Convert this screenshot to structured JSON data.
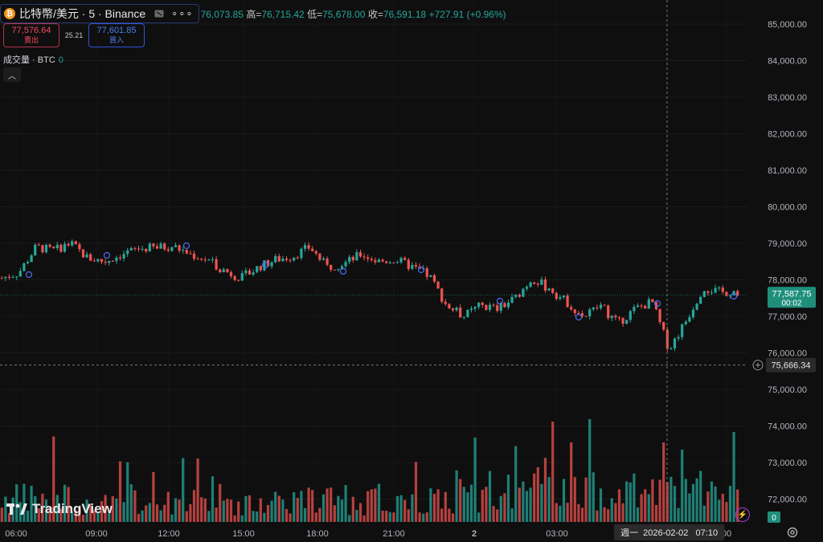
{
  "header": {
    "title": "比特幣/美元 · 5 · Binance",
    "coin_glyph": "₿",
    "more_glyph": "∘∘∘",
    "ohlc": {
      "open_value": "76,073.85",
      "high_label": "高=",
      "high_value": "76,715.42",
      "low_label": "低=",
      "low_value": "75,678.00",
      "close_label": "收=",
      "close_value": "76,591.18",
      "change": "+727.91 (+0.96%)"
    }
  },
  "trade": {
    "sell_price": "77,576.64",
    "sell_label": "賣出",
    "spread": "25.21",
    "buy_price": "77,601.85",
    "buy_label": "買入"
  },
  "volume": {
    "label": "成交量 · BTC",
    "value": "0"
  },
  "collapse_glyph": "︿",
  "price_scale": [
    "85,000.00",
    "84,000.00",
    "83,000.00",
    "82,000.00",
    "81,000.00",
    "80,000.00",
    "79,000.00",
    "78,000.00",
    "77,000.00",
    "76,000.00",
    "75,000.00",
    "74,000.00",
    "73,000.00",
    "72,000.00"
  ],
  "current_price": {
    "value": "77,587.75",
    "countdown": "00:02",
    "price": 77587.75
  },
  "crosshair": {
    "price_label": "75,666.34",
    "price": 75666.34,
    "time_label": "週一  2026-02-02   07:10"
  },
  "time_axis": [
    "06:00",
    "09:00",
    "12:00",
    "15:00",
    "18:00",
    "21:00",
    "2",
    "03:00",
    "00"
  ],
  "volume_scale_label": "0",
  "logo_text": "TradingView",
  "colors": {
    "up": "#26a69a",
    "down": "#ef5350",
    "background": "#0f0f0f",
    "accent": "#2962ff"
  },
  "icons": [
    "bitcoin-icon",
    "eye-off-icon",
    "more-icon",
    "chevron-up-icon",
    "settings-icon",
    "lightning-icon",
    "plus-circle-icon"
  ],
  "chart_data": {
    "type": "candlestick",
    "price_range": [
      71600,
      85300
    ],
    "candle_close_path": [
      {
        "time": "06:00",
        "price": 78050
      },
      {
        "time": "06:40",
        "price": 78200
      },
      {
        "time": "07:10",
        "price": 78900
      },
      {
        "time": "08:00",
        "price": 78800
      },
      {
        "time": "08:40",
        "price": 79000
      },
      {
        "time": "09:20",
        "price": 78600
      },
      {
        "time": "10:00",
        "price": 78500
      },
      {
        "time": "10:40",
        "price": 78700
      },
      {
        "time": "11:20",
        "price": 78850
      },
      {
        "time": "12:00",
        "price": 78880
      },
      {
        "time": "12:40",
        "price": 78920
      },
      {
        "time": "13:20",
        "price": 78700
      },
      {
        "time": "14:00",
        "price": 78550
      },
      {
        "time": "14:40",
        "price": 78250
      },
      {
        "time": "15:20",
        "price": 78050
      },
      {
        "time": "16:00",
        "price": 78350
      },
      {
        "time": "16:40",
        "price": 78550
      },
      {
        "time": "17:20",
        "price": 78650
      },
      {
        "time": "18:00",
        "price": 78900
      },
      {
        "time": "18:40",
        "price": 78350
      },
      {
        "time": "19:20",
        "price": 78450
      },
      {
        "time": "20:00",
        "price": 78700
      },
      {
        "time": "20:40",
        "price": 78500
      },
      {
        "time": "21:20",
        "price": 78550
      },
      {
        "time": "22:00",
        "price": 78350
      },
      {
        "time": "22:40",
        "price": 78100
      },
      {
        "time": "23:10",
        "price": 77300
      },
      {
        "time": "23:40",
        "price": 77000
      },
      {
        "time": "00:20",
        "price": 77300
      },
      {
        "time": "01:00",
        "price": 77200
      },
      {
        "time": "01:40",
        "price": 77500
      },
      {
        "time": "02:20",
        "price": 78050
      },
      {
        "time": "03:00",
        "price": 77750
      },
      {
        "time": "03:40",
        "price": 77400
      },
      {
        "time": "04:20",
        "price": 77000
      },
      {
        "time": "05:00",
        "price": 77300
      },
      {
        "time": "05:40",
        "price": 76800
      },
      {
        "time": "06:20",
        "price": 77200
      },
      {
        "time": "06:50",
        "price": 77400
      },
      {
        "time": "07:10",
        "price": 76100
      },
      {
        "time": "07:40",
        "price": 76900
      },
      {
        "time": "08:20",
        "price": 77800
      },
      {
        "time": "08:50",
        "price": 77650
      },
      {
        "time": "09:20",
        "price": 77700
      }
    ],
    "volume_visible_max_btc": "not labeled"
  }
}
